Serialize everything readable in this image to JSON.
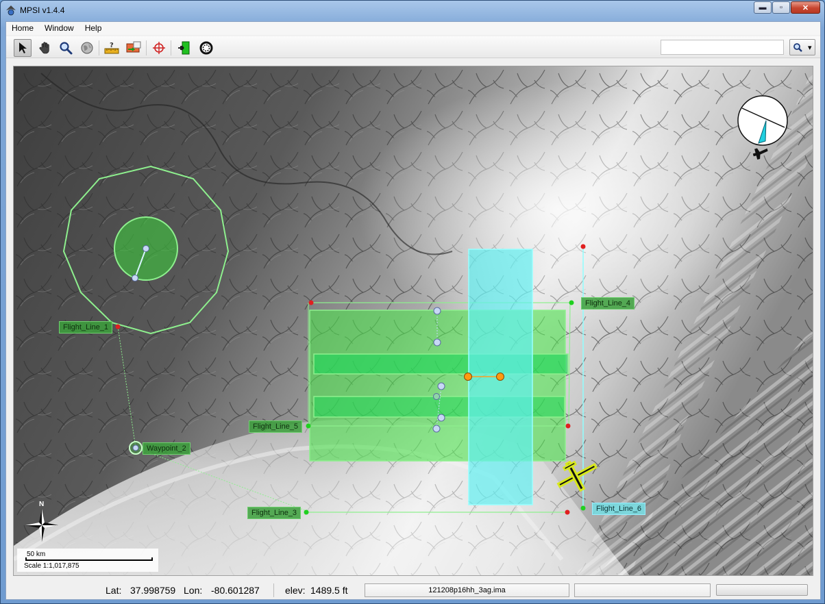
{
  "window": {
    "title": "MPSI v1.4.4",
    "minimize": "▬",
    "maximize": "▫",
    "close": "✕"
  },
  "menu": [
    "Home",
    "Window",
    "Help"
  ],
  "toolbar": {
    "tools": [
      "select-arrow-icon",
      "pan-hand-icon",
      "zoom-magnifier-icon",
      "globe-icon",
      "measure-ruler-icon",
      "camera-import-icon",
      "crosshair-target-icon",
      "aircraft-export-icon",
      "circle-waypoint-icon"
    ],
    "search_value": "",
    "search_button_arrow": "▾"
  },
  "map": {
    "flight_lines": [
      {
        "id": "Flight_Line_1",
        "label": "Flight_Line_1"
      },
      {
        "id": "Flight_Line_3",
        "label": "Flight_Line_3"
      },
      {
        "id": "Flight_Line_4",
        "label": "Flight_Line_4"
      },
      {
        "id": "Flight_Line_5",
        "label": "Flight_Line_5"
      },
      {
        "id": "Flight_Line_6",
        "label": "Flight_Line_6"
      }
    ],
    "waypoint_label": "Waypoint_2",
    "north_label": "N",
    "scale": {
      "distance": "50 km",
      "ratio": "Scale 1:1,017,875"
    },
    "colors": {
      "green_fill": "#3fd13f",
      "cyan_fill": "#6fe8ee",
      "line_green": "#7cf07c",
      "aircraft_yellow": "#d8e81c"
    }
  },
  "status": {
    "lat_label": "Lat:",
    "lat_value": "37.998759",
    "lon_label": "Lon:",
    "lon_value": "-80.601287",
    "elev_label": "elev:",
    "elev_value": "1489.5 ft",
    "file": "121208p16hh_3ag.ima",
    "field2": ""
  }
}
